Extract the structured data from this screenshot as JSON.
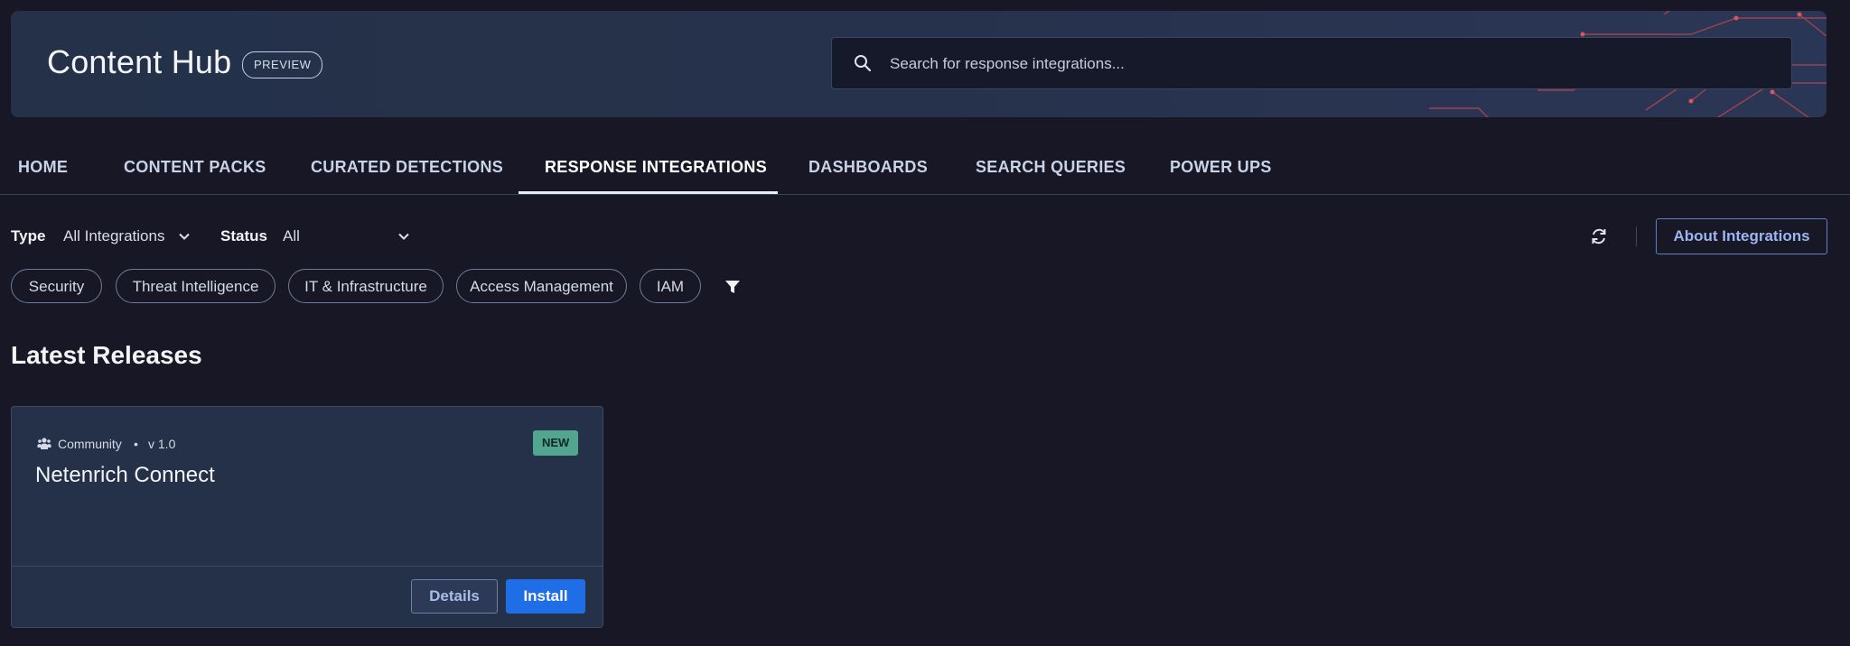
{
  "header": {
    "title": "Content Hub",
    "badge": "PREVIEW",
    "search_placeholder": "Search for response integrations..."
  },
  "tabs": [
    {
      "label": "HOME",
      "active": false
    },
    {
      "label": "CONTENT PACKS",
      "active": false
    },
    {
      "label": "CURATED DETECTIONS",
      "active": false
    },
    {
      "label": "RESPONSE INTEGRATIONS",
      "active": true
    },
    {
      "label": "DASHBOARDS",
      "active": false
    },
    {
      "label": "SEARCH QUERIES",
      "active": false
    },
    {
      "label": "POWER UPS",
      "active": false
    }
  ],
  "filters": {
    "type_label": "Type",
    "type_value": "All Integrations",
    "status_label": "Status",
    "status_value": "All"
  },
  "toolbar": {
    "about_label": "About Integrations"
  },
  "chips": [
    "Security",
    "Threat Intelligence",
    "IT & Infrastructure",
    "Access Management",
    "IAM"
  ],
  "section": {
    "title": "Latest Releases"
  },
  "card": {
    "source": "Community",
    "separator": "•",
    "version": "v 1.0",
    "badge": "NEW",
    "title": "Netenrich Connect",
    "details_label": "Details",
    "install_label": "Install"
  },
  "icons": {
    "search": "search-icon",
    "chevron": "chevron-down-icon",
    "refresh": "refresh-icon",
    "filter": "filter-icon",
    "community": "community-icon"
  },
  "colors": {
    "background": "#171725",
    "accent_blue": "#1f6ee8",
    "new_badge": "#52a58f",
    "circuit_red": "#c94a4a"
  }
}
